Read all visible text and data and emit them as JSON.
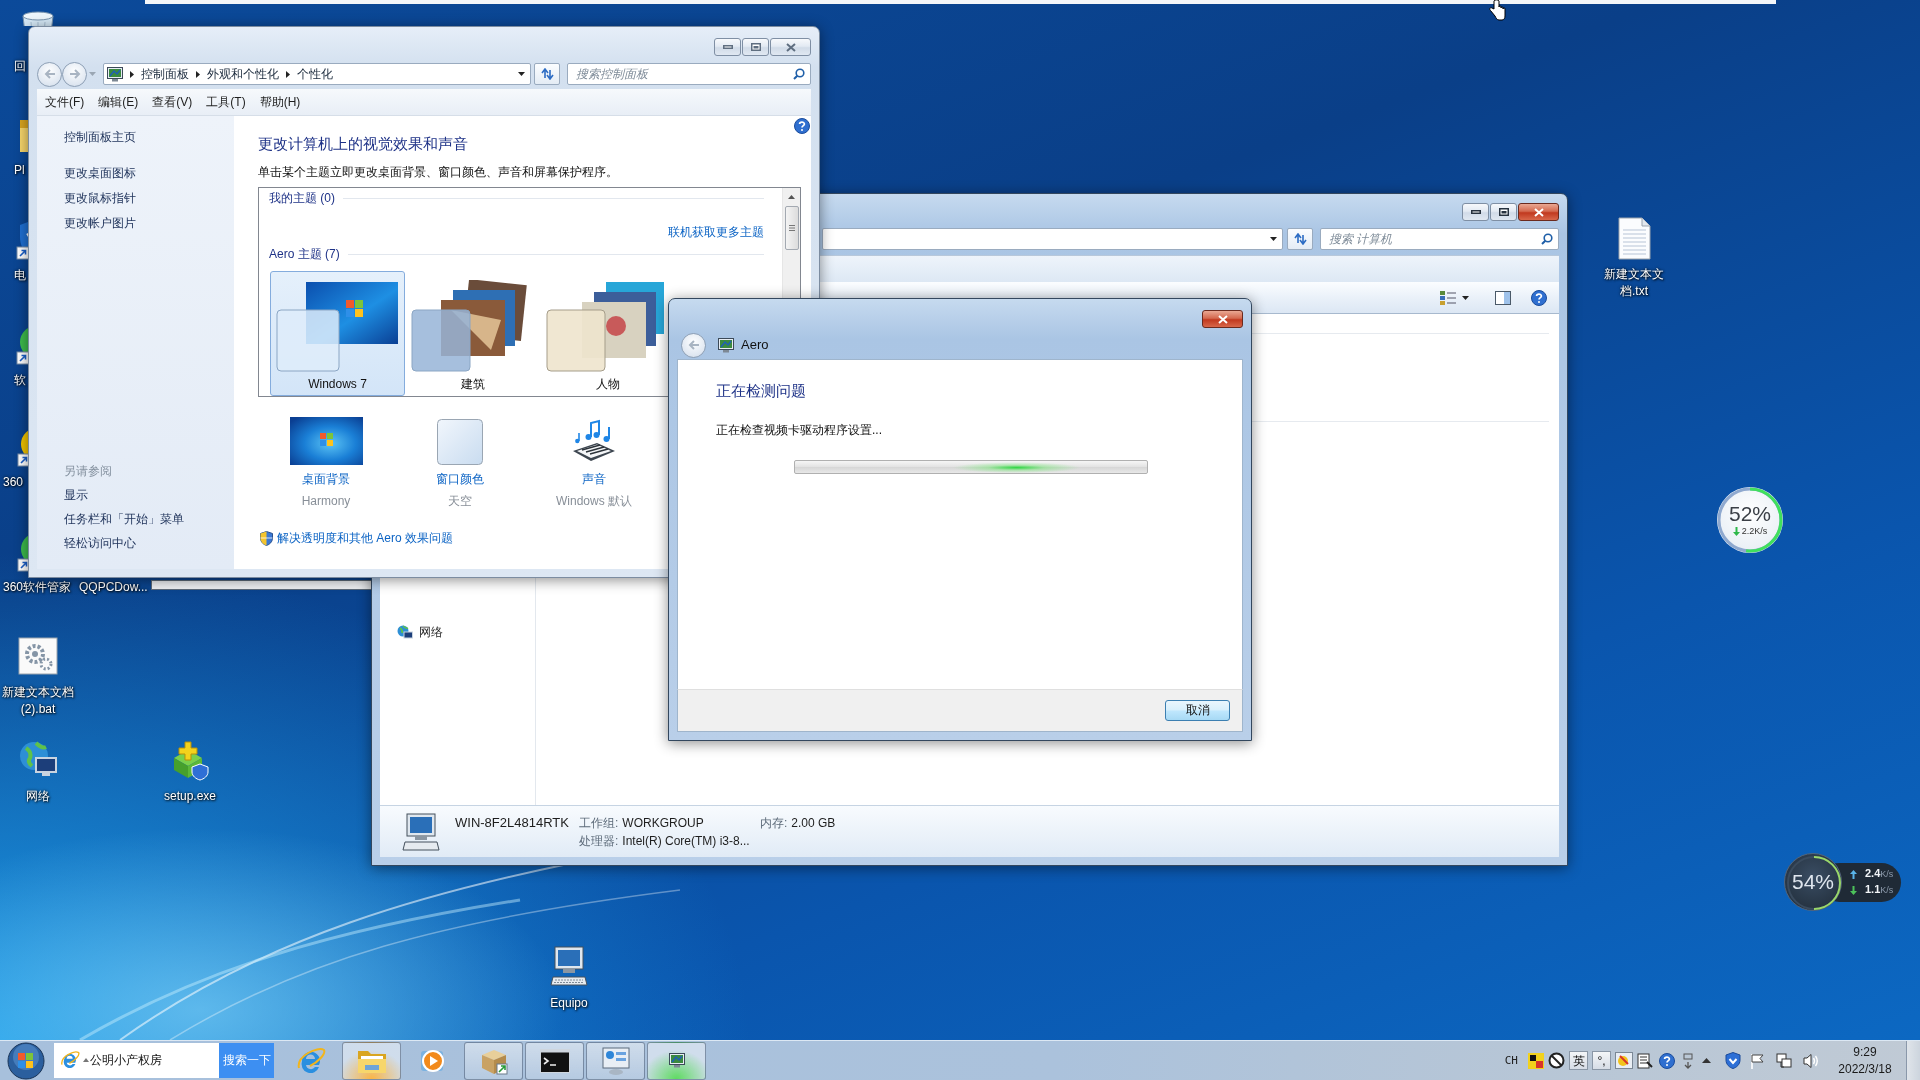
{
  "desktop": {
    "icons": [
      {
        "label": "回",
        "kind": "recycle-bin"
      },
      {
        "label": "Pl",
        "kind": "folder"
      },
      {
        "label": "电",
        "kind": "shield-shortcut"
      },
      {
        "label": "软",
        "kind": "green-shortcut"
      },
      {
        "label": "360",
        "kind": "yellow-shortcut"
      },
      {
        "label": "360软件管家",
        "kind": "green-shortcut"
      },
      {
        "label": "QQPCDow...",
        "kind": "covered"
      },
      {
        "label": "新建文本文档 (2).bat",
        "kind": "batch-file"
      },
      {
        "label": "网络",
        "kind": "network"
      },
      {
        "label": "setup.exe",
        "kind": "installer"
      },
      {
        "label": "Equipo",
        "kind": "computer"
      },
      {
        "label": "新建文本文档.txt",
        "kind": "text-file"
      }
    ]
  },
  "widgets": [
    {
      "kind": "light-ring",
      "percent": "52%",
      "level": 0.52,
      "speed": "2.2K/s"
    },
    {
      "kind": "dark-ring",
      "percent": "54%",
      "level": 0.5,
      "upload": "**2.4**K/s",
      "download": "**1.1**K/s"
    }
  ],
  "control_panel": {
    "active": false,
    "breadcrumb": [
      "控制面板",
      "外观和个性化",
      "个性化"
    ],
    "search": {
      "placeholder": "搜索控制面板"
    },
    "menu": [
      "文件(F)",
      "编辑(E)",
      "查看(V)",
      "工具(T)",
      "帮助(H)"
    ],
    "sidebar": {
      "home": "控制面板主页",
      "tasks": [
        "更改桌面图标",
        "更改鼠标指针",
        "更改帐户图片"
      ],
      "see_also": {
        "heading": "另请参阅",
        "links": [
          "显示",
          "任务栏和「开始」菜单",
          "轻松访问中心"
        ]
      }
    },
    "title": "更改计算机上的视觉效果和声音",
    "subtitle": "单击某个主题立即更改桌面背景、窗口颜色、声音和屏幕保护程序。",
    "theme_groups": [
      {
        "heading": "我的主题 (0)",
        "link": "联机获取更多主题"
      },
      {
        "heading": "Aero 主题 (7)",
        "themes": [
          {
            "name": "Windows 7",
            "kind": "windows7",
            "selected": true
          },
          {
            "name": "建筑",
            "kind": "architecture",
            "selected": false
          },
          {
            "name": "人物",
            "kind": "characters",
            "selected": false
          }
        ]
      }
    ],
    "settings": [
      {
        "kind": "background",
        "label": "桌面背景",
        "value": "Harmony"
      },
      {
        "kind": "color",
        "label": "窗口颜色",
        "value": "天空"
      },
      {
        "kind": "sound",
        "label": "声音",
        "value": "Windows 默认"
      }
    ],
    "troubleshoot_link": "解决透明度和其他 Aero 效果问题"
  },
  "explorer": {
    "active": true,
    "search": {
      "placeholder": "搜索 计算机"
    },
    "navigation": [
      "网络"
    ],
    "details": {
      "computer_name": "WIN-8F2L4814RTK",
      "fields": [
        {
          "label": "工作组:",
          "value": "WORKGROUP"
        },
        {
          "label": "内存:",
          "value": "2.00 GB"
        },
        {
          "label": "处理器:",
          "value": "Intel(R) Core(TM) i3-8..."
        }
      ]
    }
  },
  "dialog": {
    "active": true,
    "title": "Aero",
    "heading": "正在检测问题",
    "status": "正在检查视频卡驱动程序设置...",
    "progress": {
      "kind": "marquee"
    },
    "buttons": [
      "取消"
    ]
  },
  "taskbar": {
    "search": {
      "value": "公明小产权房",
      "button": "搜索一下"
    },
    "apps": [
      {
        "kind": "browser",
        "running": false,
        "highlighted": false
      },
      {
        "kind": "folder",
        "running": true,
        "highlighted": true
      },
      {
        "kind": "media-player",
        "running": false,
        "highlighted": false
      },
      {
        "kind": "package",
        "running": true,
        "highlighted": false
      },
      {
        "kind": "terminal",
        "running": true,
        "highlighted": false
      },
      {
        "kind": "control-panel",
        "running": true,
        "highlighted": false
      },
      {
        "kind": "display",
        "running": true,
        "highlighted": true
      }
    ],
    "tray": {
      "language": "CH",
      "ime_mode": "英",
      "ime_punctuation": "°,"
    },
    "clock": {
      "time": "9:29",
      "date": "2022/3/18"
    }
  }
}
